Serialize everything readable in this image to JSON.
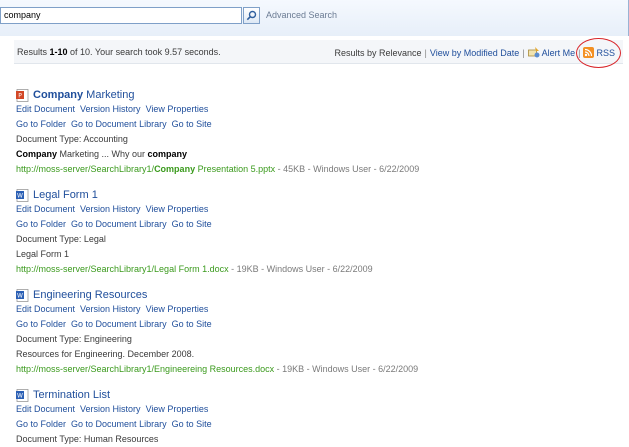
{
  "search": {
    "query": "company",
    "advanced_label": "Advanced Search"
  },
  "summary": {
    "prefix": "Results ",
    "range": "1-10",
    "suffix": " of 10. Your search took 9.57 seconds."
  },
  "sort": {
    "relevance": "Results by Relevance",
    "modified": "View by Modified Date",
    "alert": "Alert Me",
    "rss": "RSS"
  },
  "actions": {
    "edit": "Edit Document",
    "version": "Version History",
    "properties": "View Properties",
    "folder": "Go to Folder",
    "library": "Go to Document Library",
    "site": "Go to Site"
  },
  "results": [
    {
      "icon": "powerpoint-icon",
      "title_bold": "Company",
      "title_rest": " Marketing",
      "doc_type": "Document Type: Accounting",
      "desc_b1": "Company",
      "desc_mid": " Marketing ... Why our ",
      "desc_b2": "company",
      "url_pre": "http://moss-server/SearchLibrary1/",
      "url_bold": "Company",
      "url_post": " Presentation 5.pptx",
      "url_extra": " - 45KB - Windows User - 6/22/2009"
    },
    {
      "icon": "word-icon",
      "title_bold": "",
      "title_rest": "Legal Form 1",
      "doc_type": "Document Type: Legal",
      "desc_b1": "",
      "desc_mid": "Legal Form 1",
      "desc_b2": "",
      "url_pre": "http://moss-server/SearchLibrary1/Legal Form 1.docx",
      "url_bold": "",
      "url_post": "",
      "url_extra": " - 19KB - Windows User - 6/22/2009"
    },
    {
      "icon": "word-icon",
      "title_bold": "",
      "title_rest": "Engineering Resources",
      "doc_type": "Document Type: Engineering",
      "desc_b1": "",
      "desc_mid": "Resources for Engineering. December 2008.",
      "desc_b2": "",
      "url_pre": "http://moss-server/SearchLibrary1/Engineereing Resources.docx",
      "url_bold": "",
      "url_post": "",
      "url_extra": " - 19KB - Windows User - 6/22/2009"
    },
    {
      "icon": "word-icon",
      "title_bold": "",
      "title_rest": "Termination List",
      "doc_type": "Document Type: Human Resources",
      "desc_b1": "",
      "desc_mid": "",
      "desc_b2": "",
      "url_pre": "",
      "url_bold": "",
      "url_post": "",
      "url_extra": ""
    }
  ]
}
